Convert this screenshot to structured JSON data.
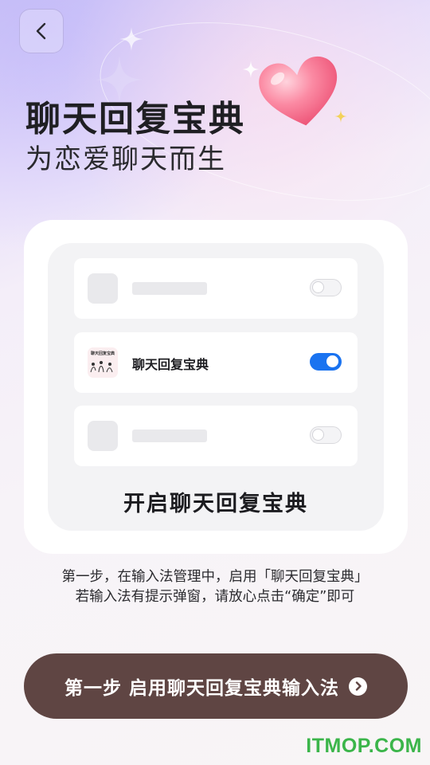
{
  "header": {
    "title": "聊天回复宝典",
    "subtitle": "为恋爱聊天而生"
  },
  "icons": {
    "back": "chevron-left-icon",
    "heart": "heart-icon",
    "sparkle": "sparkle-icon",
    "cta_arrow": "chevron-right-circle-icon"
  },
  "preview": {
    "rows": [
      {
        "type": "placeholder",
        "toggle": "off"
      },
      {
        "type": "app",
        "name": "聊天回复宝典",
        "icon_text": "聊天回复宝典",
        "toggle": "on"
      },
      {
        "type": "placeholder",
        "toggle": "off"
      }
    ],
    "enable_label": "开启聊天回复宝典"
  },
  "instructions": {
    "line1": "第一步，在输入法管理中，启用「聊天回复宝典」",
    "line2": "若输入法有提示弹窗，请放心点击“确定”即可"
  },
  "cta": {
    "label": "第一步 启用聊天回复宝典输入法"
  },
  "watermark": "ITMOP.COM",
  "colors": {
    "cta_bg": "#5f4543",
    "toggle_on": "#1a73f0",
    "heart": "#f46b8a",
    "watermark": "#3bb54a"
  }
}
